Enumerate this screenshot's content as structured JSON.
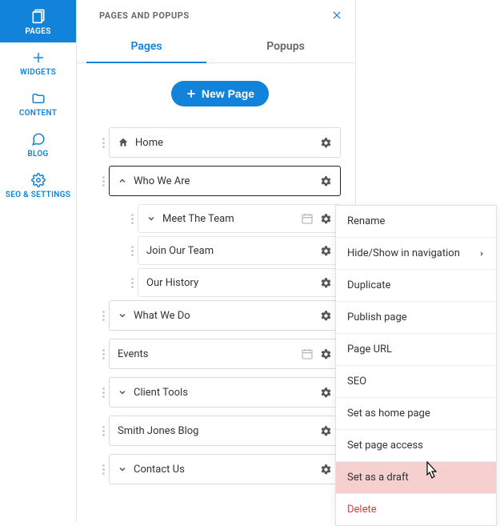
{
  "sidebar": {
    "items": [
      {
        "label": "PAGES"
      },
      {
        "label": "WIDGETS"
      },
      {
        "label": "CONTENT"
      },
      {
        "label": "BLOG"
      },
      {
        "label": "SEO & SETTINGS"
      }
    ]
  },
  "panel": {
    "title": "PAGES AND POPUPS",
    "tabs": [
      {
        "label": "Pages",
        "active": true
      },
      {
        "label": "Popups",
        "active": false
      }
    ],
    "new_page_label": "New Page"
  },
  "pages": [
    {
      "label": "Home",
      "icon": "home"
    },
    {
      "label": "Who We Are",
      "icon": "chevron-up",
      "selected": true,
      "children": [
        {
          "label": "Meet The Team",
          "icon": "chevron-down",
          "calendar": true
        },
        {
          "label": "Join Our Team"
        },
        {
          "label": "Our History"
        }
      ]
    },
    {
      "label": "What We Do",
      "icon": "chevron-down"
    },
    {
      "label": "Events",
      "calendar": true
    },
    {
      "label": "Client Tools",
      "icon": "chevron-down"
    },
    {
      "label": "Smith Jones Blog"
    },
    {
      "label": "Contact Us",
      "icon": "chevron-down"
    }
  ],
  "context_menu": {
    "items": [
      {
        "label": "Rename"
      },
      {
        "label": "Hide/Show in navigation",
        "submenu": true
      },
      {
        "label": "Duplicate"
      },
      {
        "label": "Publish page"
      },
      {
        "label": "Page URL"
      },
      {
        "label": "SEO"
      },
      {
        "label": "Set as home page"
      },
      {
        "label": "Set page access"
      },
      {
        "label": "Set as a draft",
        "highlight": true
      },
      {
        "label": "Delete",
        "danger": true
      }
    ]
  }
}
